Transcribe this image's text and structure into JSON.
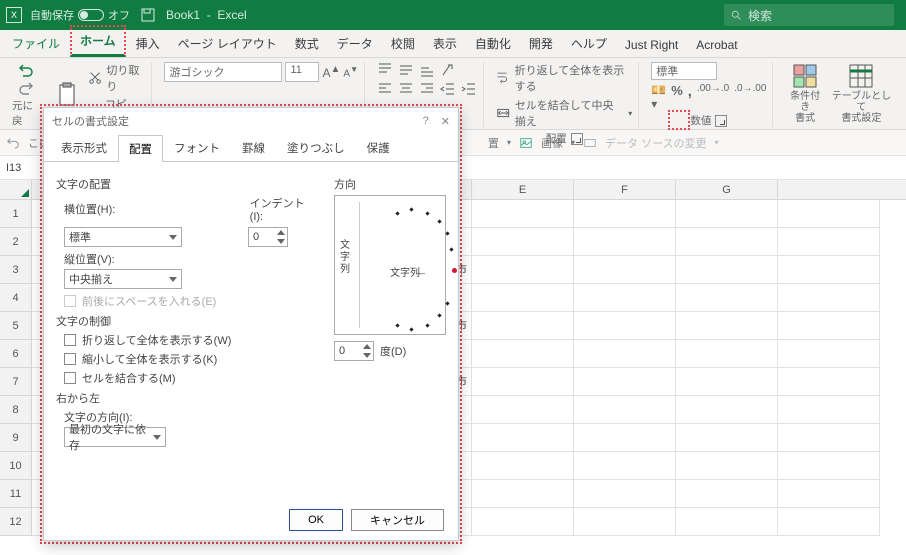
{
  "titlebar": {
    "autosave_label": "自動保存",
    "autosave_state": "オフ",
    "doc_name": "Book1",
    "app_name": "Excel",
    "search_placeholder": "検索"
  },
  "tabs": {
    "file": "ファイル",
    "home": "ホーム",
    "insert": "挿入",
    "layout": "ページ レイアウト",
    "formulas": "数式",
    "data": "データ",
    "review": "校閲",
    "view": "表示",
    "automate": "自動化",
    "developer": "開発",
    "help": "ヘルプ",
    "justright": "Just Right",
    "acrobat": "Acrobat"
  },
  "ribbon": {
    "undo_label": "元に戻",
    "clipboard": {
      "cut": "切り取り",
      "copy": "コピー"
    },
    "font": {
      "name": "游ゴシック",
      "size": "11"
    },
    "alignment": {
      "wrap": "折り返して全体を表示する",
      "merge": "セルを結合して中央揃え",
      "group_label": "配置"
    },
    "number": {
      "format": "標準",
      "group_label": "数値"
    },
    "styles": {
      "cond": "条件付き\n書式",
      "table": "テーブルとして\n書式設定"
    }
  },
  "secondbar": {
    "undo_txt": "この",
    "align_drop": "置",
    "image": "画像",
    "datasource": "データ ソースの変更"
  },
  "namebox": "I13",
  "columns": [
    "E",
    "F",
    "G"
  ],
  "row_numbers": [
    "1",
    "2",
    "3",
    "4",
    "5",
    "6",
    "7",
    "8",
    "9",
    "10",
    "11",
    "12"
  ],
  "cell_fragments": {
    "r3": "市",
    "r5": "市",
    "r7": "市"
  },
  "dialog": {
    "title": "セルの書式設定",
    "tabs": {
      "number": "表示形式",
      "alignment": "配置",
      "font": "フォント",
      "border": "罫線",
      "fill": "塗りつぶし",
      "protect": "保護"
    },
    "text_align_group": "文字の配置",
    "horizontal_lbl": "横位置(H):",
    "horizontal_val": "標準",
    "indent_lbl": "インデント(I):",
    "indent_val": "0",
    "vertical_lbl": "縦位置(V):",
    "vertical_val": "中央揃え",
    "justify_dist": "前後にスペースを入れる(E)",
    "text_ctrl_group": "文字の制御",
    "wrap_chk": "折り返して全体を表示する(W)",
    "shrink_chk": "縮小して全体を表示する(K)",
    "merge_chk": "セルを結合する(M)",
    "rtl_group": "右から左",
    "direction_lbl": "文字の方向(I):",
    "direction_val": "最初の文字に依存",
    "orient_group": "方向",
    "orient_vtext": "文字列",
    "orient_htext": "文字列",
    "degree_val": "0",
    "degree_lbl": "度(D)",
    "ok": "OK",
    "cancel": "キャンセル"
  }
}
